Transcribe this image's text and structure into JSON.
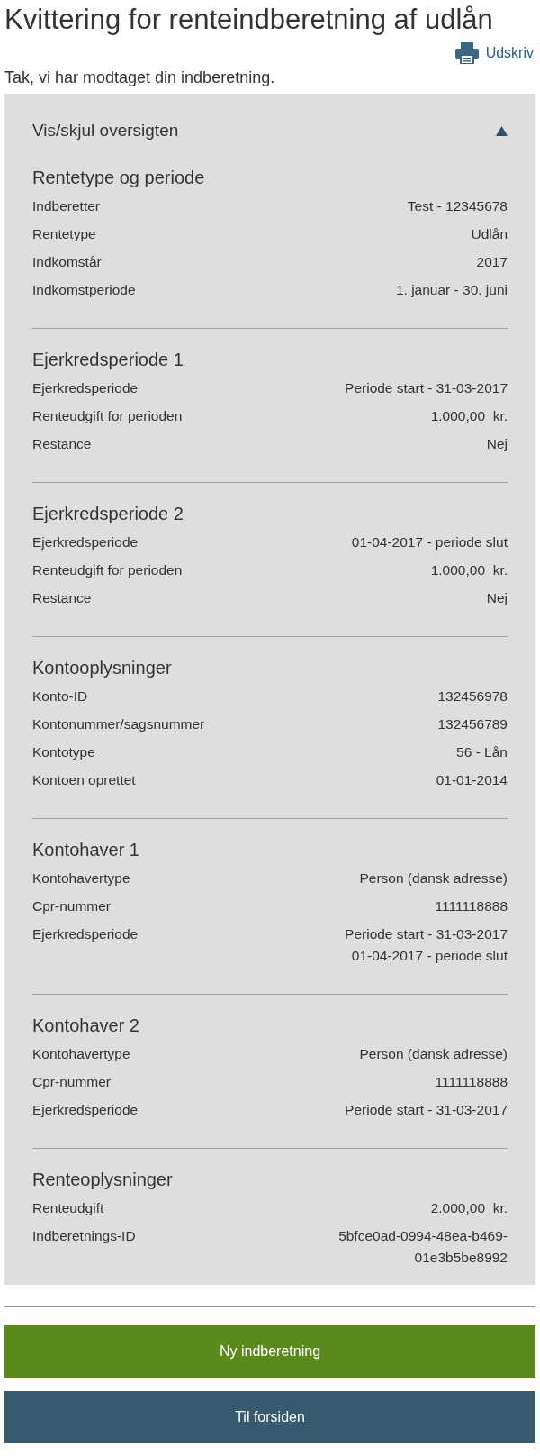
{
  "title": "Kvittering for renteindberetning af udlån",
  "print_link": {
    "label": "Udskriv"
  },
  "message": "Tak, vi har modtaget din indberetning.",
  "overview": {
    "toggle_label": "Vis/skjul oversigten",
    "expanded": true,
    "sections": [
      {
        "heading": "Rentetype og periode",
        "rows": [
          {
            "label": "Indberetter",
            "value": [
              "Test - 12345678"
            ]
          },
          {
            "label": "Rentetype",
            "value": [
              "Udlån"
            ]
          },
          {
            "label": "Indkomstår",
            "value": [
              "2017"
            ]
          },
          {
            "label": "Indkomstperiode",
            "value": [
              "1. januar - 30. juni"
            ]
          }
        ]
      },
      {
        "heading": "Ejerkredsperiode 1",
        "rows": [
          {
            "label": "Ejerkredsperiode",
            "value": [
              "Periode start - 31-03-2017"
            ]
          },
          {
            "label": "Renteudgift for perioden",
            "value": [
              "1.000,00  kr."
            ]
          },
          {
            "label": "Restance",
            "value": [
              "Nej"
            ]
          }
        ]
      },
      {
        "heading": "Ejerkredsperiode 2",
        "rows": [
          {
            "label": "Ejerkredsperiode",
            "value": [
              "01-04-2017 - periode slut"
            ]
          },
          {
            "label": "Renteudgift for perioden",
            "value": [
              "1.000,00  kr."
            ]
          },
          {
            "label": "Restance",
            "value": [
              "Nej"
            ]
          }
        ]
      },
      {
        "heading": "Kontooplysninger",
        "rows": [
          {
            "label": "Konto-ID",
            "value": [
              "132456978"
            ]
          },
          {
            "label": "Kontonummer/sagsnummer",
            "value": [
              "132456789"
            ]
          },
          {
            "label": "Kontotype",
            "value": [
              "56 - Lån"
            ]
          },
          {
            "label": "Kontoen oprettet",
            "value": [
              "01-01-2014"
            ]
          }
        ]
      },
      {
        "heading": "Kontohaver 1",
        "rows": [
          {
            "label": "Kontohavertype",
            "value": [
              "Person (dansk adresse)"
            ]
          },
          {
            "label": "Cpr-nummer",
            "value": [
              "1111118888"
            ]
          },
          {
            "label": "Ejerkredsperiode",
            "value": [
              "Periode start - 31-03-2017",
              "01-04-2017 - periode slut"
            ]
          }
        ]
      },
      {
        "heading": "Kontohaver 2",
        "rows": [
          {
            "label": "Kontohavertype",
            "value": [
              "Person (dansk adresse)"
            ]
          },
          {
            "label": "Cpr-nummer",
            "value": [
              "1111118888"
            ]
          },
          {
            "label": "Ejerkredsperiode",
            "value": [
              "Periode start - 31-03-2017"
            ]
          }
        ]
      },
      {
        "heading": "Renteoplysninger",
        "rows": [
          {
            "label": "Renteudgift",
            "value": [
              "2.000,00  kr."
            ]
          },
          {
            "label": "Indberetnings-ID",
            "value": [
              "5bfce0ad-0994-48ea-b469-",
              "01e3b5be8992"
            ]
          }
        ]
      }
    ]
  },
  "buttons": [
    {
      "label": "Ny indberetning",
      "kind": "primary"
    },
    {
      "label": "Til forsiden",
      "kind": "secondary"
    }
  ]
}
